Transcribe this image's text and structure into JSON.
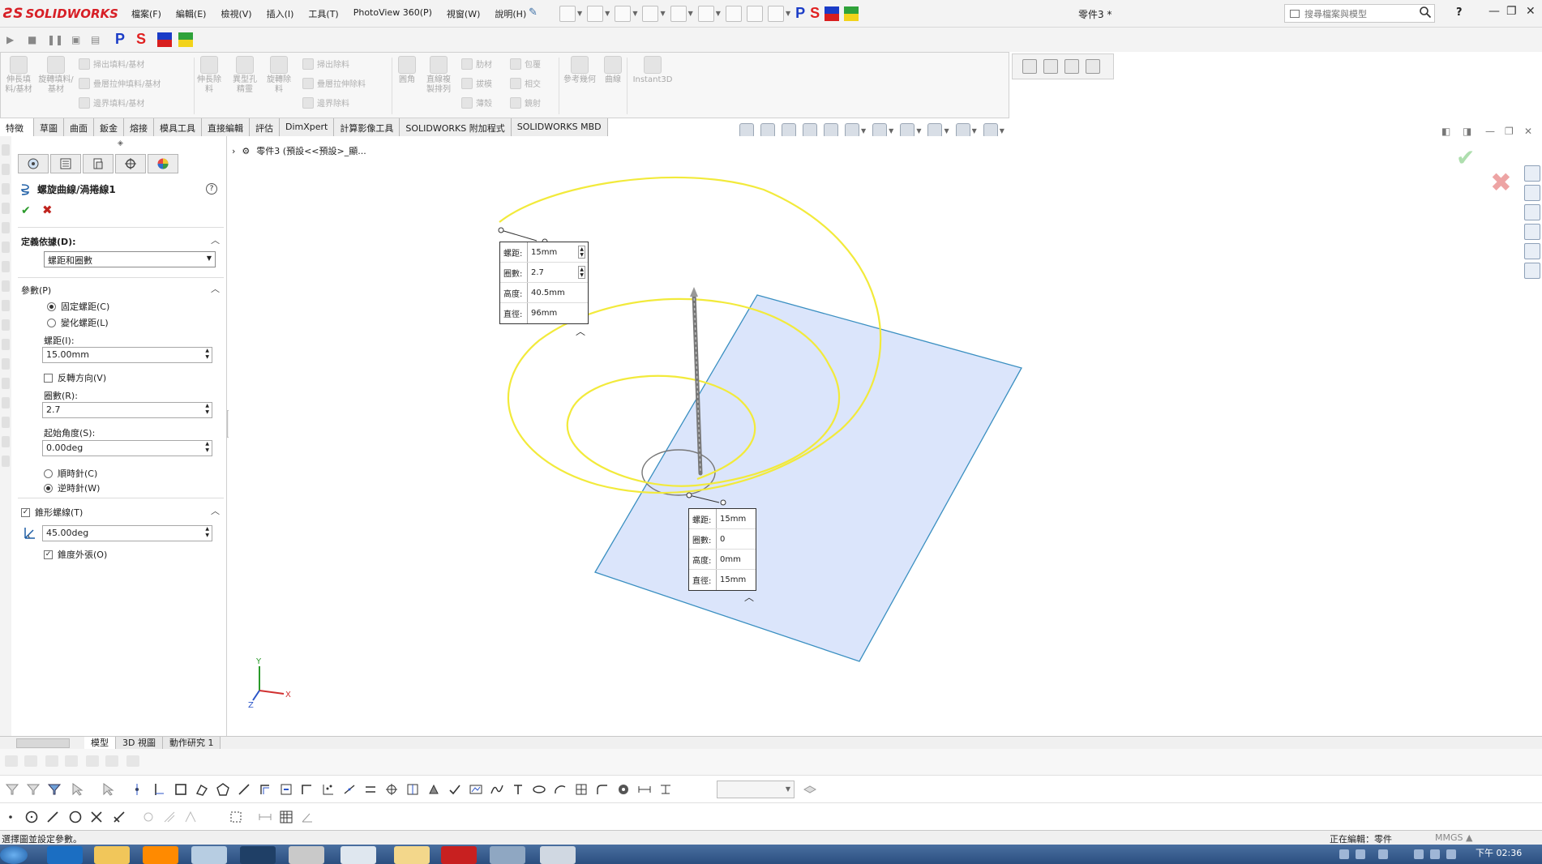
{
  "app": {
    "logo": "SOLIDWORKS",
    "menu": [
      "檔案(F)",
      "編輯(E)",
      "檢視(V)",
      "插入(I)",
      "工具(T)",
      "PhotoView 360(P)",
      "視窗(W)",
      "說明(H)"
    ],
    "doc_title": "零件3 *",
    "search_placeholder": "搜尋檔案與模型",
    "help": "?",
    "badge_p": "P",
    "badge_s": "S"
  },
  "command_manager": {
    "groups": [
      {
        "label": "伸長填料/基材"
      },
      {
        "label": "旋轉填料/基材"
      },
      {
        "label": "伸長除料"
      },
      {
        "label": "異型孔精靈"
      },
      {
        "label": "旋轉除料"
      },
      {
        "label": "圓角"
      },
      {
        "label": "直線複製排列"
      },
      {
        "label": "參考幾何"
      },
      {
        "label": "曲線"
      },
      {
        "label": "Instant3D"
      }
    ],
    "small_items": [
      "掃出填料/基材",
      "疊層拉伸填料/基材",
      "邊界填料/基材",
      "掃出除料",
      "疊層拉伸除料",
      "邊界除料",
      "肋材",
      "包覆",
      "拔模",
      "相交",
      "薄殼",
      "鏡射"
    ]
  },
  "tabs": [
    "特徵",
    "草圖",
    "曲面",
    "鈑金",
    "熔接",
    "模具工具",
    "直接編輯",
    "評估",
    "DimXpert",
    "計算影像工具",
    "SOLIDWORKS 附加程式",
    "SOLIDWORKS MBD"
  ],
  "tree_crumb": "零件3 (預設<<預設>_顯...",
  "property_manager": {
    "title": "螺旋曲線/渦捲線1",
    "define_by": {
      "header": "定義依據(D):",
      "selected": "螺距和圈數"
    },
    "params": {
      "header": "參數(P)",
      "constant_pitch": "固定螺距(C)",
      "variable_pitch": "變化螺距(L)",
      "pitch_label": "螺距(I):",
      "pitch_value": "15.00mm",
      "reverse_label": "反轉方向(V)",
      "revolutions_label": "圈數(R):",
      "revolutions_value": "2.7",
      "start_angle_label": "起始角度(S):",
      "start_angle_value": "0.00deg",
      "clockwise": "順時針(C)",
      "counterclockwise": "逆時針(W)"
    },
    "taper": {
      "header": "錐形螺線(T)",
      "angle_value": "45.00deg",
      "outward_label": "錐度外張(O)"
    }
  },
  "callout_top": {
    "rows": [
      {
        "k": "螺距:",
        "v": "15mm"
      },
      {
        "k": "圈數:",
        "v": "2.7"
      },
      {
        "k": "高度:",
        "v": "40.5mm"
      },
      {
        "k": "直徑:",
        "v": "96mm"
      }
    ]
  },
  "callout_bottom": {
    "rows": [
      {
        "k": "螺距:",
        "v": "15mm"
      },
      {
        "k": "圈數:",
        "v": "0"
      },
      {
        "k": "高度:",
        "v": "0mm"
      },
      {
        "k": "直徑:",
        "v": "15mm"
      }
    ]
  },
  "triad": {
    "x": "X",
    "y": "Y",
    "z": "Z"
  },
  "bottom_tabs": [
    "模型",
    "3D 視圖",
    "動作研究 1"
  ],
  "status": {
    "left": "選擇圖並設定參數。",
    "editing": "正在編輯：零件",
    "units": "MMGS ▲"
  },
  "clock": "下午 02:36",
  "colors": {
    "helix": "#f2ea3b",
    "plane_fill": "#dbe5fb",
    "plane_edge": "#3a8fc1",
    "brand_red": "#d71f26"
  }
}
